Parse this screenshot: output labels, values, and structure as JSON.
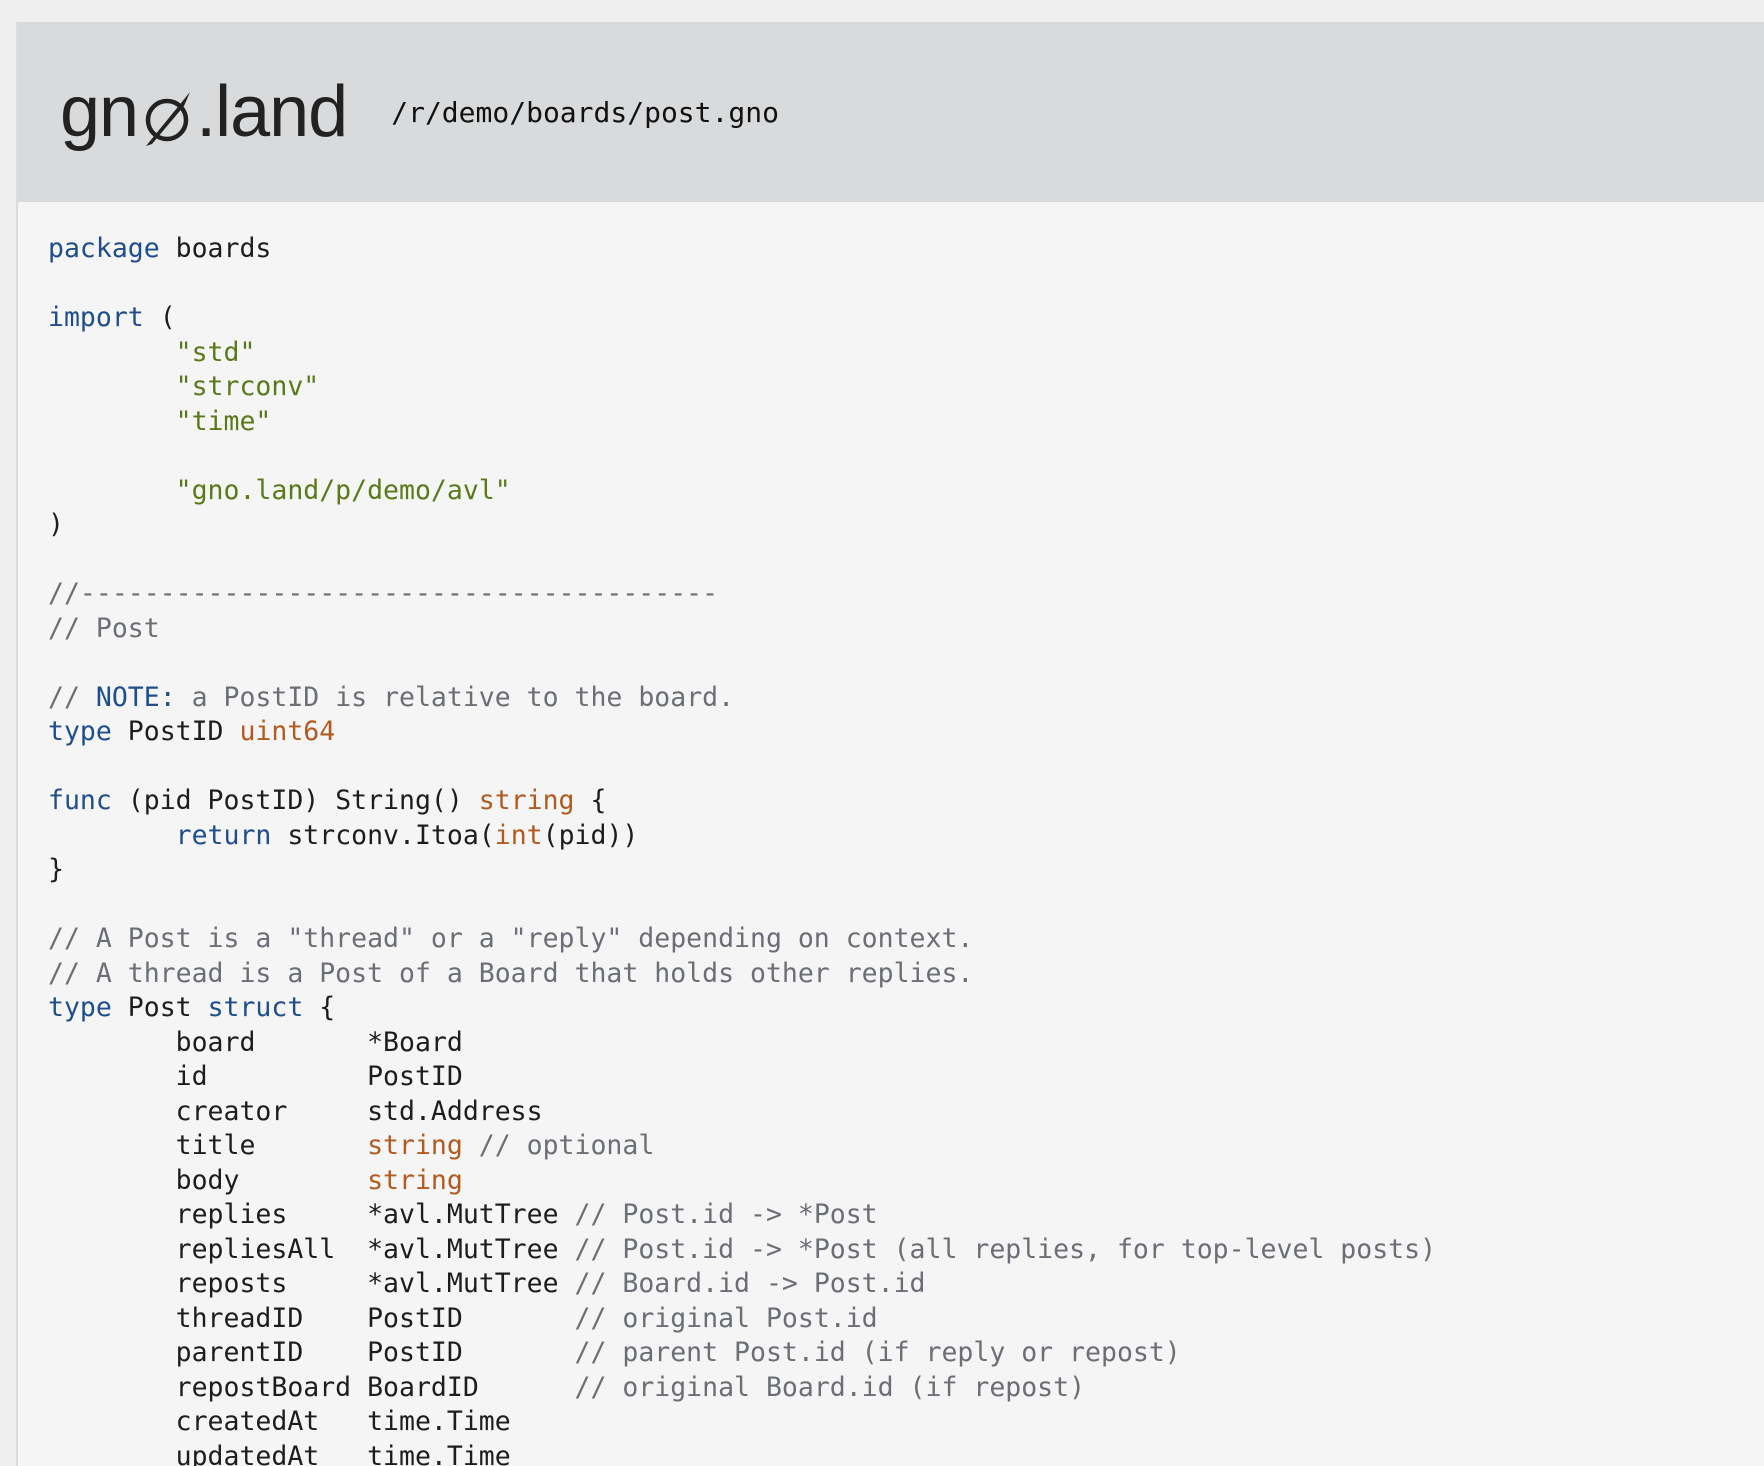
{
  "header": {
    "logo_text_left": "gn",
    "logo_text_right": ".land",
    "path": "/r/demo/boards/post.gno"
  },
  "colors": {
    "keyword": "#1f4e8c",
    "string": "#5a7a1a",
    "builtin_type": "#b35a1f",
    "comment": "#6b6f75",
    "header_bg": "#d9dadc",
    "code_bg": "#f5f5f5"
  },
  "code_lines": [
    [
      {
        "t": "kw",
        "v": "package"
      },
      {
        "t": "id",
        "v": " boards"
      }
    ],
    [],
    [
      {
        "t": "kw",
        "v": "import"
      },
      {
        "t": "id",
        "v": " ("
      }
    ],
    [
      {
        "t": "id",
        "v": "        "
      },
      {
        "t": "str",
        "v": "\"std\""
      }
    ],
    [
      {
        "t": "id",
        "v": "        "
      },
      {
        "t": "str",
        "v": "\"strconv\""
      }
    ],
    [
      {
        "t": "id",
        "v": "        "
      },
      {
        "t": "str",
        "v": "\"time\""
      }
    ],
    [],
    [
      {
        "t": "id",
        "v": "        "
      },
      {
        "t": "str",
        "v": "\"gno.land/p/demo/avl\""
      }
    ],
    [
      {
        "t": "id",
        "v": ")"
      }
    ],
    [],
    [
      {
        "t": "com",
        "v": "//----------------------------------------"
      }
    ],
    [
      {
        "t": "com",
        "v": "// Post"
      }
    ],
    [],
    [
      {
        "t": "com",
        "v": "// "
      },
      {
        "t": "note",
        "v": "NOTE:"
      },
      {
        "t": "com",
        "v": " a PostID is relative to the board."
      }
    ],
    [
      {
        "t": "kw",
        "v": "type"
      },
      {
        "t": "id",
        "v": " PostID "
      },
      {
        "t": "type",
        "v": "uint64"
      }
    ],
    [],
    [
      {
        "t": "kw",
        "v": "func"
      },
      {
        "t": "id",
        "v": " (pid PostID) String() "
      },
      {
        "t": "type",
        "v": "string"
      },
      {
        "t": "id",
        "v": " {"
      }
    ],
    [
      {
        "t": "id",
        "v": "        "
      },
      {
        "t": "kw",
        "v": "return"
      },
      {
        "t": "id",
        "v": " strconv.Itoa("
      },
      {
        "t": "type",
        "v": "int"
      },
      {
        "t": "id",
        "v": "(pid))"
      }
    ],
    [
      {
        "t": "id",
        "v": "}"
      }
    ],
    [],
    [
      {
        "t": "com",
        "v": "// A Post is a \"thread\" or a \"reply\" depending on context."
      }
    ],
    [
      {
        "t": "com",
        "v": "// A thread is a Post of a Board that holds other replies."
      }
    ],
    [
      {
        "t": "kw",
        "v": "type"
      },
      {
        "t": "id",
        "v": " Post "
      },
      {
        "t": "kw",
        "v": "struct"
      },
      {
        "t": "id",
        "v": " {"
      }
    ],
    [
      {
        "t": "id",
        "v": "        board       *Board"
      }
    ],
    [
      {
        "t": "id",
        "v": "        id          PostID"
      }
    ],
    [
      {
        "t": "id",
        "v": "        creator     std.Address"
      }
    ],
    [
      {
        "t": "id",
        "v": "        title       "
      },
      {
        "t": "type",
        "v": "string"
      },
      {
        "t": "com",
        "v": " // optional"
      }
    ],
    [
      {
        "t": "id",
        "v": "        body        "
      },
      {
        "t": "type",
        "v": "string"
      }
    ],
    [
      {
        "t": "id",
        "v": "        replies     *avl.MutTree "
      },
      {
        "t": "com",
        "v": "// Post.id -> *Post"
      }
    ],
    [
      {
        "t": "id",
        "v": "        repliesAll  *avl.MutTree "
      },
      {
        "t": "com",
        "v": "// Post.id -> *Post (all replies, for top-level posts)"
      }
    ],
    [
      {
        "t": "id",
        "v": "        reposts     *avl.MutTree "
      },
      {
        "t": "com",
        "v": "// Board.id -> Post.id"
      }
    ],
    [
      {
        "t": "id",
        "v": "        threadID    PostID       "
      },
      {
        "t": "com",
        "v": "// original Post.id"
      }
    ],
    [
      {
        "t": "id",
        "v": "        parentID    PostID       "
      },
      {
        "t": "com",
        "v": "// parent Post.id (if reply or repost)"
      }
    ],
    [
      {
        "t": "id",
        "v": "        repostBoard BoardID      "
      },
      {
        "t": "com",
        "v": "// original Board.id (if repost)"
      }
    ],
    [
      {
        "t": "id",
        "v": "        createdAt   time.Time"
      }
    ],
    [
      {
        "t": "id",
        "v": "        updatedAt   time.Time"
      }
    ]
  ]
}
